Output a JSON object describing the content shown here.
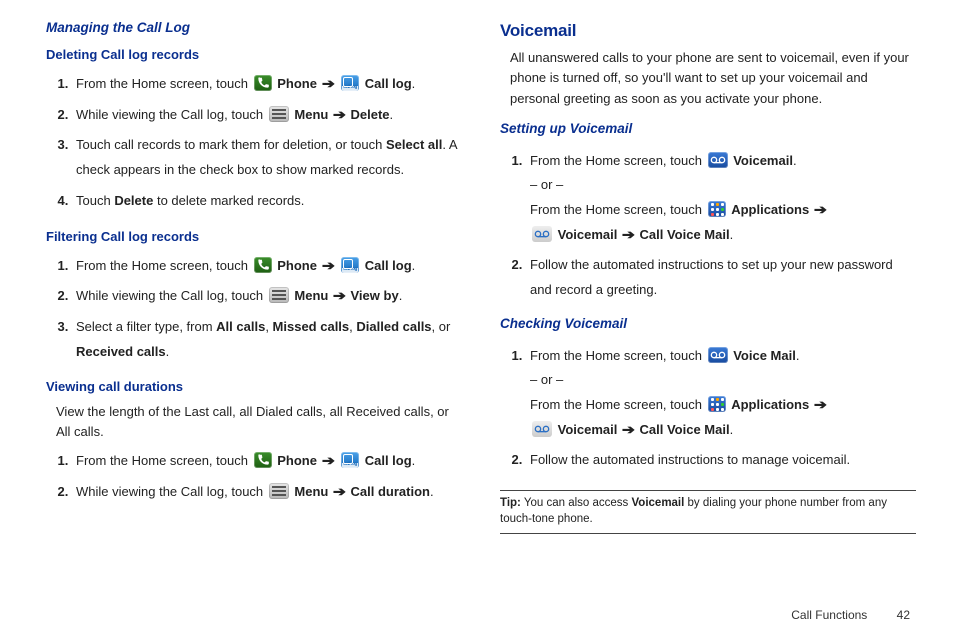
{
  "left": {
    "h1": "Managing the Call Log",
    "sec1": {
      "title": "Deleting Call log records",
      "items": [
        {
          "pre": "From the Home screen, touch ",
          "b1": "Phone",
          "b2": "Call log",
          "post": "."
        },
        {
          "pre": "While viewing the Call log, touch ",
          "b1": "Menu",
          "b2": "Delete",
          "post": "."
        },
        {
          "text1": "Touch call records to mark them for deletion, or touch ",
          "b1": "Select all",
          "text2": ". A check appears in the check box to show marked records."
        },
        {
          "text1": "Touch ",
          "b1": "Delete",
          "text2": " to delete marked records."
        }
      ]
    },
    "sec2": {
      "title": "Filtering Call log records",
      "items": [
        {
          "pre": "From the Home screen, touch ",
          "b1": "Phone",
          "b2": "Call log",
          "post": "."
        },
        {
          "pre": "While viewing the Call log, touch ",
          "b1": "Menu",
          "b2": "View by",
          "post": "."
        },
        {
          "t1": "Select a filter type, from ",
          "f1": "All calls",
          "s1": ", ",
          "f2": "Missed calls",
          "s2": ", ",
          "f3": "Dialled calls",
          "s3": ", or ",
          "f4": "Received calls",
          "s4": "."
        }
      ]
    },
    "sec3": {
      "title": "Viewing call durations",
      "intro": "View the length of the Last call, all Dialed calls, all Received calls, or All calls.",
      "items": [
        {
          "pre": "From the Home screen, touch ",
          "b1": "Phone",
          "b2": "Call log",
          "post": "."
        },
        {
          "pre": "While viewing the Call log, touch ",
          "b1": "Menu",
          "b2": "Call duration",
          "post": "."
        }
      ]
    }
  },
  "right": {
    "h1": "Voicemail",
    "intro": "All unanswered calls to your phone are sent to voicemail, even if your phone is turned off, so you'll want to set up your voicemail and personal greeting as soon as you activate your phone.",
    "sec1": {
      "title": "Setting up Voicemail",
      "items": [
        {
          "l1a": "From the Home screen, touch ",
          "l1b": "Voicemail",
          "l1c": ".",
          "or": "– or –",
          "l2a": "From the Home screen, touch ",
          "l2b": "Applications",
          "l3b": "Voicemail",
          "l3c": "Call Voice Mail",
          "l3d": "."
        },
        {
          "text": "Follow the automated instructions to set up your new password and record a greeting."
        }
      ]
    },
    "sec2": {
      "title": "Checking Voicemail",
      "items": [
        {
          "l1a": "From the Home screen, touch ",
          "l1b": "Voice Mail",
          "l1c": ".",
          "or": "– or –",
          "l2a": "From the Home screen, touch ",
          "l2b": "Applications",
          "l3b": "Voicemail",
          "l3c": "Call Voice Mail",
          "l3d": "."
        },
        {
          "text": "Follow the automated instructions to manage voicemail."
        }
      ]
    },
    "tip": {
      "label": "Tip:",
      "t1": " You can also access ",
      "b": "Voicemail",
      "t2": " by dialing your phone number from any touch-tone phone."
    }
  },
  "footer": {
    "section": "Call Functions",
    "page": "42"
  }
}
